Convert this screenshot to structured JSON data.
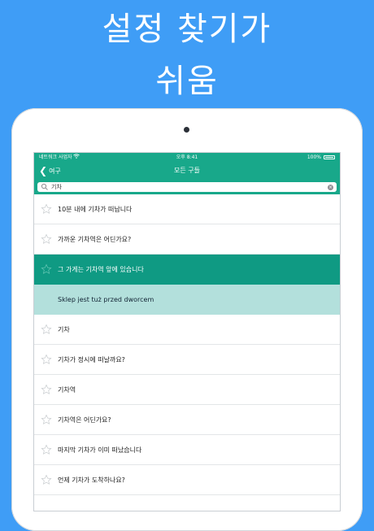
{
  "promo": {
    "line1": "설정 찾기가",
    "line2": "쉬움"
  },
  "status_bar": {
    "carrier": "네트워크 사업자",
    "time": "오후 8:41",
    "battery": "100%"
  },
  "nav": {
    "back_label": "여구",
    "title": "모든 구들"
  },
  "search": {
    "value": "기차"
  },
  "colors": {
    "background": "#3f9df6",
    "accent": "#18a88a",
    "selected_row": "#0f9a83",
    "translation_row": "#b3e0dc"
  },
  "phrases": [
    {
      "text": "10분 내에 기차가 떠납니다"
    },
    {
      "text": "가까운 기차역은 어딘가요?"
    },
    {
      "text": "그 가게는 기차역 앞에 있습니다"
    },
    {
      "text": "Sklep jest tuż przed dworcem"
    },
    {
      "text": "기차"
    },
    {
      "text": "기차가 정시에 떠날까요?"
    },
    {
      "text": "기차역"
    },
    {
      "text": "기차역은 어딘가요?"
    },
    {
      "text": "마지막 기차가 이미 떠났습니다"
    },
    {
      "text": "언제 기차가 도착하나요?"
    }
  ]
}
